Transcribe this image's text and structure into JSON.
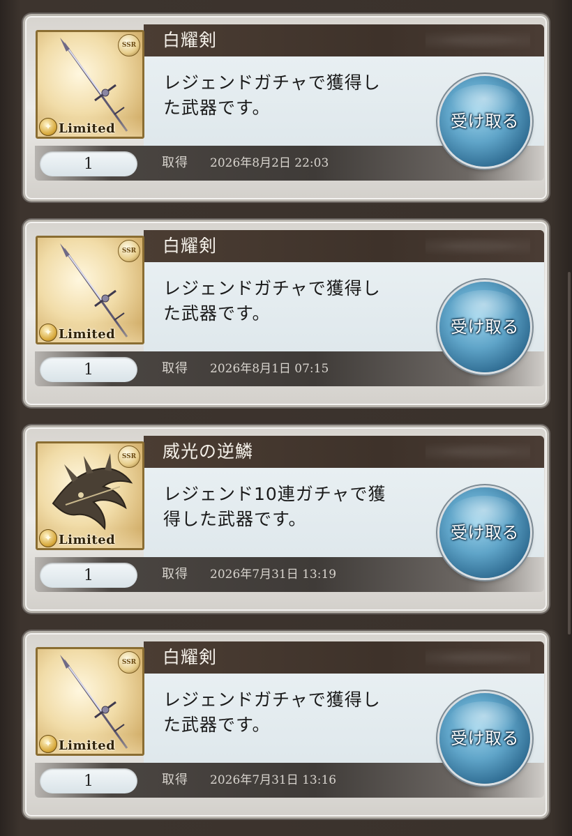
{
  "items": [
    {
      "name": "白耀剣",
      "desc_line1": "レジェンドガチャで獲得し",
      "desc_line2": "た武器です。",
      "quantity": "1",
      "obtained_label": "取得",
      "obtained_date": "2026年8月2日 22:03",
      "receive_label": "受け取る",
      "rarity": "SSR",
      "badge": "Limited",
      "icon": "spear-icon"
    },
    {
      "name": "白耀剣",
      "desc_line1": "レジェンドガチャで獲得し",
      "desc_line2": "た武器です。",
      "quantity": "1",
      "obtained_label": "取得",
      "obtained_date": "2026年8月1日 07:15",
      "receive_label": "受け取る",
      "rarity": "SSR",
      "badge": "Limited",
      "icon": "spear-icon"
    },
    {
      "name": "威光の逆鱗",
      "desc_line1": "レジェンド10連ガチャで獲",
      "desc_line2": "得した武器です。",
      "quantity": "1",
      "obtained_label": "取得",
      "obtained_date": "2026年7月31日 13:19",
      "receive_label": "受け取る",
      "rarity": "SSR",
      "badge": "Limited",
      "icon": "dragon-weapon-icon"
    },
    {
      "name": "白耀剣",
      "desc_line1": "レジェンドガチャで獲得し",
      "desc_line2": "た武器です。",
      "quantity": "1",
      "obtained_label": "取得",
      "obtained_date": "2026年7月31日 13:16",
      "receive_label": "受け取る",
      "rarity": "SSR",
      "badge": "Limited",
      "icon": "spear-icon"
    }
  ]
}
